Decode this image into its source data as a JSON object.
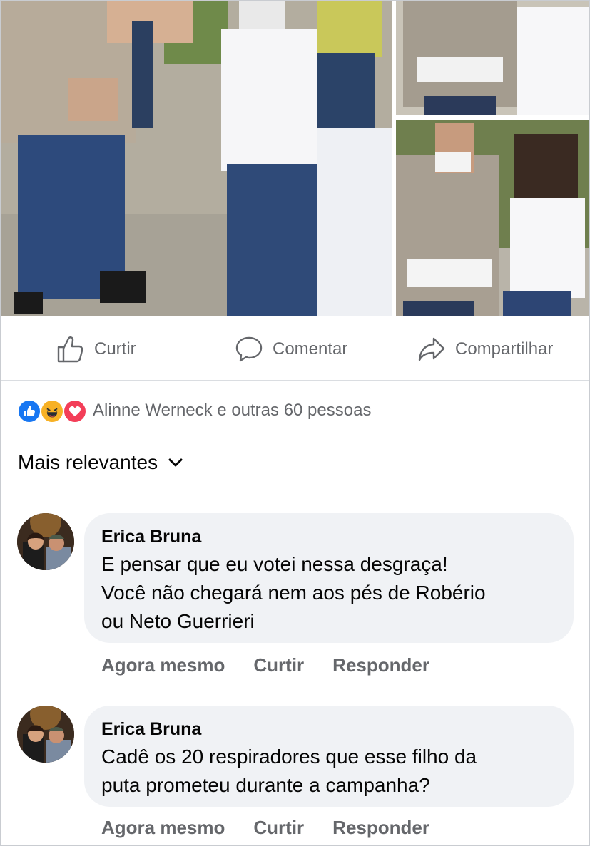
{
  "post": {
    "photos": [
      "photo-main",
      "photo-top-right",
      "photo-bottom-right"
    ]
  },
  "actions": {
    "like_label": "Curtir",
    "comment_label": "Comentar",
    "share_label": "Compartilhar"
  },
  "reactions": {
    "icons": [
      "like-reaction-icon",
      "haha-reaction-icon",
      "love-reaction-icon"
    ],
    "summary": "Alinne Werneck e outras 60 pessoas"
  },
  "sort": {
    "label": "Mais relevantes"
  },
  "comments": [
    {
      "author": "Erica Bruna",
      "lines": [
        "E pensar que eu votei nessa desgraça!",
        "Você não chegará nem aos pés de Robério",
        "ou Neto Guerrieri"
      ],
      "time": "Agora mesmo",
      "like_label": "Curtir",
      "reply_label": "Responder"
    },
    {
      "author": "Erica Bruna",
      "lines": [
        "Cadê os 20 respiradores que esse filho da",
        "puta prometeu durante a campanha?"
      ],
      "time": "Agora mesmo",
      "like_label": "Curtir",
      "reply_label": "Responder"
    }
  ],
  "colors": {
    "secondary_text": "#65676b",
    "bubble": "#f0f2f5",
    "like_blue": "#1877f2",
    "haha_yellow": "#f7b125",
    "love_red": "#f33e58"
  }
}
